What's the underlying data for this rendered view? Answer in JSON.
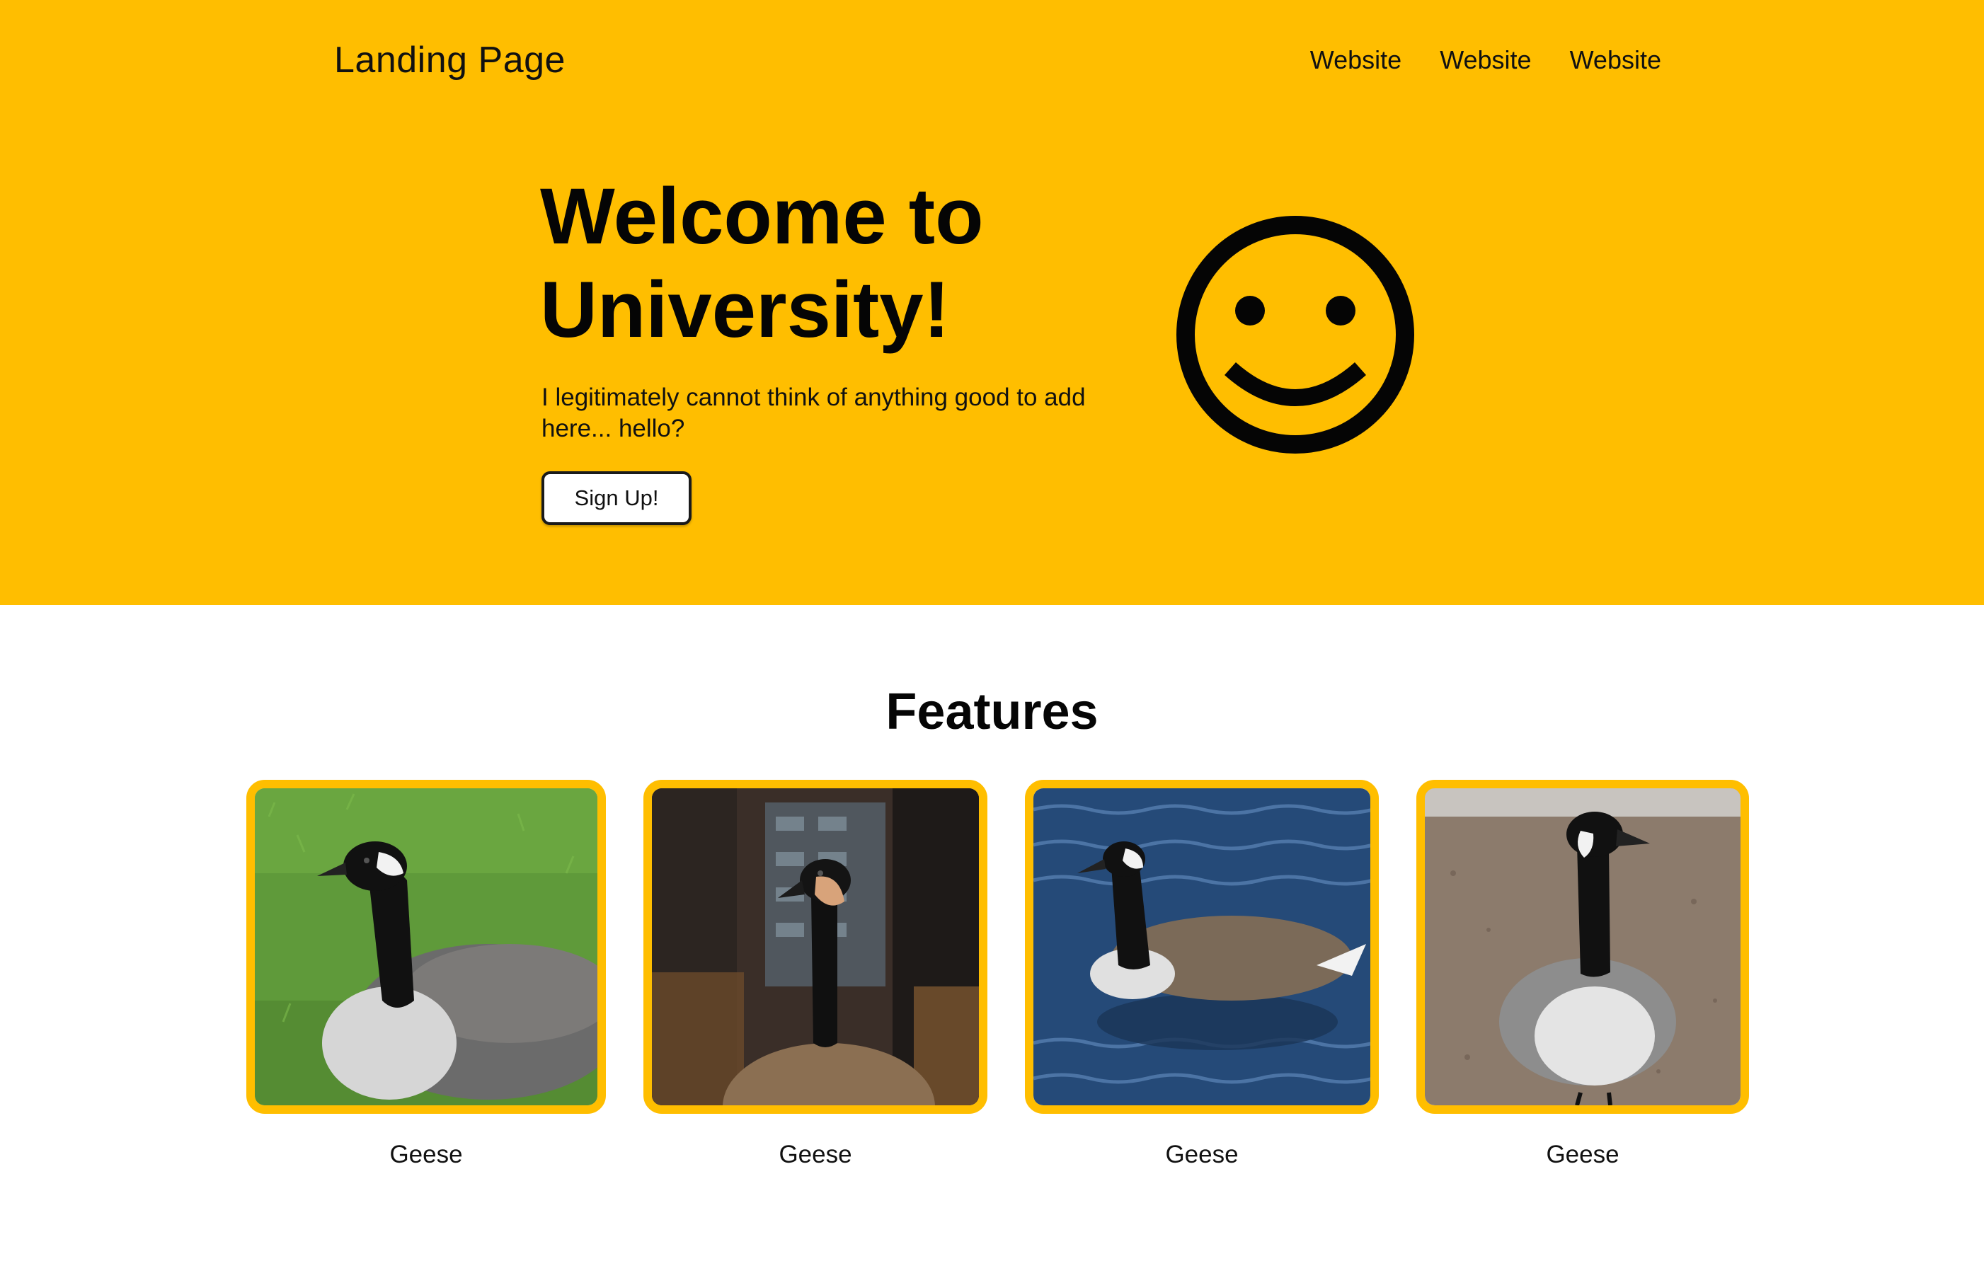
{
  "header": {
    "brand": "Landing Page",
    "nav": [
      "Website",
      "Website",
      "Website"
    ]
  },
  "hero": {
    "title_line1": "Welcome to",
    "title_line2": "University!",
    "subtitle": "I legitimately cannot think of anything good to add here... hello?",
    "cta_label": "Sign Up!",
    "icon": "smiley-face-icon"
  },
  "features": {
    "title": "Features",
    "items": [
      {
        "caption": "Geese",
        "image": "canada-goose-on-grass"
      },
      {
        "caption": "Geese",
        "image": "canada-goose-portrait"
      },
      {
        "caption": "Geese",
        "image": "canada-goose-swimming"
      },
      {
        "caption": "Geese",
        "image": "canada-goose-standing"
      }
    ]
  },
  "colors": {
    "accent": "#FFBE00",
    "text": "#000000",
    "background": "#FFFFFF"
  }
}
